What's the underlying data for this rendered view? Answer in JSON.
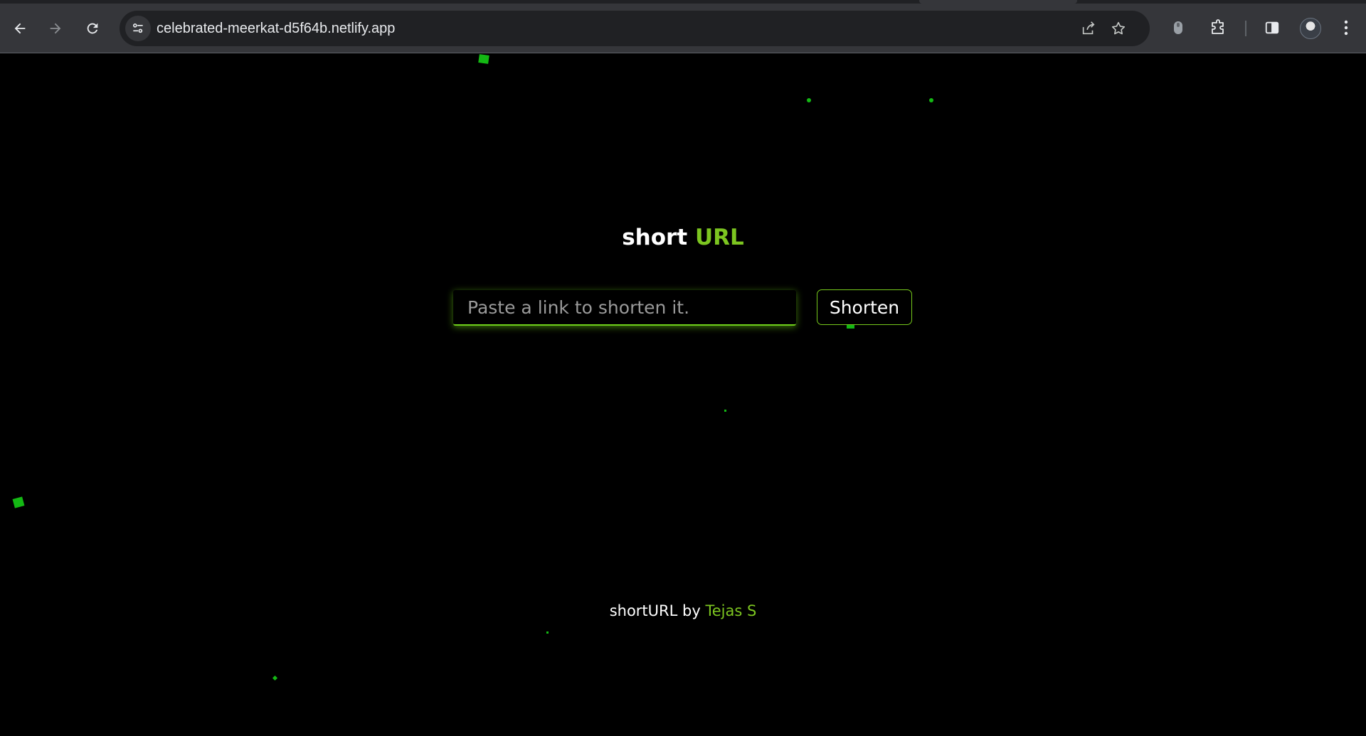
{
  "browser": {
    "url": "celebrated-meerkat-d5f64b.netlify.app"
  },
  "page": {
    "title_main": "short",
    "title_accent": "URL",
    "input_placeholder": "Paste a link to shorten it.",
    "button_label": "Shorten",
    "footer_prefix": "shortURL by",
    "footer_author": "Tejas S",
    "accent_color": "#7cc520",
    "particle_color": "#14b814"
  }
}
